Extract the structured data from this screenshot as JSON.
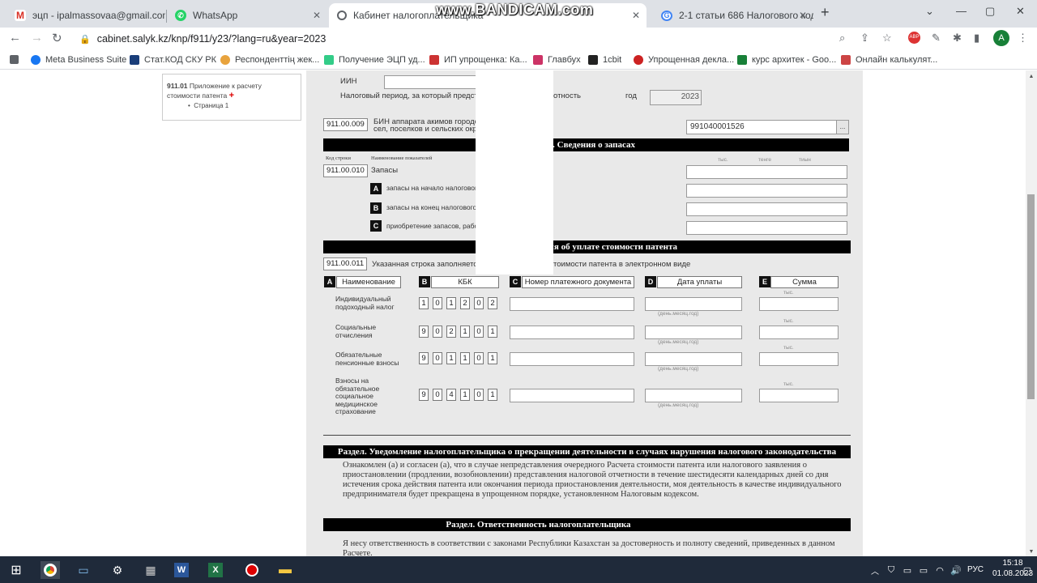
{
  "browser": {
    "tabs": [
      {
        "label": "эцп - ipalmassovaa@gmail.com",
        "icon": "gmail-icon"
      },
      {
        "label": "WhatsApp",
        "icon": "whatsapp-icon"
      },
      {
        "label": "Кабинет налогоплательщика",
        "icon": "salyk-icon"
      },
      {
        "label": "2-1 статьи 686 Налогового код...",
        "icon": "google-icon"
      }
    ],
    "watermark": "www.BANDICAM.com",
    "url": "cabinet.salyk.kz/knp/f911/y23/?lang=ru&year=2023",
    "avatar_letter": "A",
    "bookmarks": [
      "Meta Business Suite",
      "Стат.КОД СКУ РК",
      "Респонденттің жек...",
      "Получение ЭЦП уд...",
      "ИП упрощенка: Ка...",
      "Главбух",
      "1cbit",
      "Упрощенная декла...",
      "курс архитек - Goo...",
      "Онлайн калькулят..."
    ]
  },
  "sidebar": {
    "code": "911.01",
    "title": "Приложение к расчету стоимости патента",
    "page_item": "Страница 1"
  },
  "form": {
    "iin_label": "ИИН",
    "period_label": "Налоговый период, за который представ",
    "period_label_tail": "отность",
    "year_label": "год",
    "year_value": "2023",
    "akim_code": "911.00.009",
    "akim_label_line1": "БИН аппарата акимов городо",
    "akim_label_line2": "сел, поселков и сельских окру",
    "akim_value": "991040001526",
    "sec_inventory": "дл. Сведения о запасах",
    "col_code_header": "Код строки",
    "col_name_header": "Наименование показателей",
    "col_hints": [
      "тыс.",
      "тенге",
      "тиын"
    ],
    "inv_code": "911.00.010",
    "inv_label": "Запасы",
    "inv_rows": [
      {
        "letter": "A",
        "label": "запасы на начало налогового"
      },
      {
        "letter": "B",
        "label": "запасы на конец налогового"
      },
      {
        "letter": "C",
        "label": "приобретение запасов, работ,"
      }
    ],
    "sec_payment": "ния об уплате стоимости патента",
    "pay_code": "911.00.011",
    "pay_note_left": "Указанная строка заполняется",
    "pay_note_right": "тоимости патента в электронном виде",
    "pay_headers": [
      {
        "letter": "A",
        "label": "Наименование"
      },
      {
        "letter": "B",
        "label": "КБК"
      },
      {
        "letter": "C",
        "label": "Номер платежного документа"
      },
      {
        "letter": "D",
        "label": "Дата уплаты"
      },
      {
        "letter": "E",
        "label": "Сумма"
      }
    ],
    "date_hint": "(день.месяц.год)",
    "sum_hint": "тыс.",
    "pay_rows": [
      {
        "name": [
          "Индивидуальный",
          "подоходный налог"
        ],
        "kbk": [
          "1",
          "0",
          "1",
          "2",
          "0",
          "2"
        ]
      },
      {
        "name": [
          "Социальные",
          "отчисления"
        ],
        "kbk": [
          "9",
          "0",
          "2",
          "1",
          "0",
          "1"
        ]
      },
      {
        "name": [
          "Обязательные",
          "пенсионные взносы"
        ],
        "kbk": [
          "9",
          "0",
          "1",
          "1",
          "0",
          "1"
        ]
      },
      {
        "name": [
          "Взносы на",
          "обязательное",
          "социальное",
          "медицинское",
          "страхование"
        ],
        "kbk": [
          "9",
          "0",
          "4",
          "1",
          "0",
          "1"
        ]
      }
    ],
    "sec_notice": "Раздел. Уведомление налогоплательщика о прекращении деятельности в случаях нарушения налогового законодательства",
    "notice_text": "Ознакомлен (а) и согласен (а), что в случае непредставления очередного Расчета стоимости патента или налогового заявления о приостановлении (продлении, возобновлении) представления налоговой отчетности в течение шестидесяти календарных дней со дня истечения срока действия патента или окончания периода приостановления деятельности, моя деятельность в качестве индивидуального предпринимателя будет прекращена в упрощенном порядке, установленном Налоговым кодексом.",
    "sec_resp": "Раздел. Ответственность налогоплательщика",
    "resp_text": "Я несу ответственность в соответствии с законами Республики Казахстан за достоверность и полноту сведений, приведенных в данном Расчете."
  },
  "taskbar": {
    "lang": "РУС",
    "time": "15:18",
    "date": "01.08.2023"
  },
  "colors": {
    "section_bar": "#000000",
    "form_background": "#e9e9e9",
    "taskbar": "#1f2a3a"
  }
}
